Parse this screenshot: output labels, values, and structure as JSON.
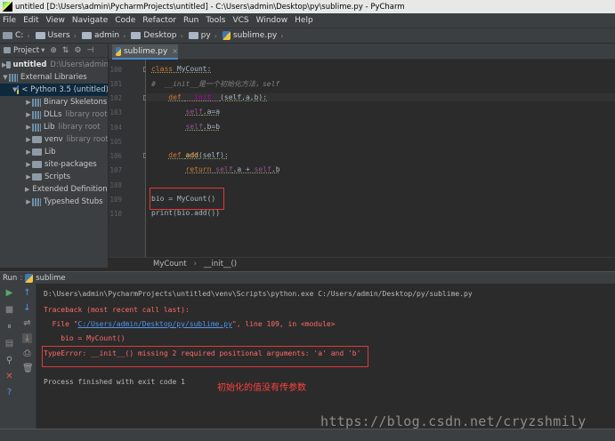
{
  "window": {
    "title": "untitled [D:\\Users\\admin\\PycharmProjects\\untitled] - C:\\Users\\admin\\Desktop\\py\\sublime.py - PyCharm"
  },
  "menu": [
    "File",
    "Edit",
    "View",
    "Navigate",
    "Code",
    "Refactor",
    "Run",
    "Tools",
    "VCS",
    "Window",
    "Help"
  ],
  "navbar": {
    "crumbs": [
      "C:",
      "Users",
      "admin",
      "Desktop",
      "py",
      "sublime.py"
    ]
  },
  "project": {
    "header": "Project",
    "tree": [
      {
        "label": "untitled",
        "hint": "D:\\Users\\admin"
      },
      {
        "label": "External Libraries",
        "hint": ""
      },
      {
        "label": "< Python 3.5 (untitled)",
        "hint": ""
      },
      {
        "label": "Binary Skeletons",
        "hint": ""
      },
      {
        "label": "DLLs",
        "hint": "library root"
      },
      {
        "label": "Lib",
        "hint": "library root"
      },
      {
        "label": "venv",
        "hint": "library root"
      },
      {
        "label": "Lib",
        "hint": ""
      },
      {
        "label": "site-packages",
        "hint": ""
      },
      {
        "label": "Scripts",
        "hint": ""
      },
      {
        "label": "Extended Definitions",
        "hint": ""
      },
      {
        "label": "Typeshed Stubs",
        "hint": ""
      }
    ]
  },
  "editor": {
    "tab": "sublime.py",
    "line_numbers": [
      "100",
      "101",
      "102",
      "103",
      "104",
      "105",
      "106",
      "107",
      "108",
      "109",
      "110"
    ],
    "lines": {
      "l100_kw": "class ",
      "l100_name": "MyCount",
      "l100_end": ":",
      "l101": "#  __init__是一个初始化方法，self",
      "l102_kw": "def ",
      "l102_name": "__init__",
      "l102_args": "(self,a,b):",
      "l103_self": "self",
      "l103_rest": ".a=a",
      "l104_self": "self",
      "l104_rest": ".b=b",
      "l106_kw": "def ",
      "l106_name": "add",
      "l106_rest": "(self):",
      "l107_kw": "return ",
      "l107_self1": "self",
      "l107_mid": ".a + ",
      "l107_self2": "self",
      "l107_end": ".b",
      "l109": "bio = MyCount()",
      "l110": "print(bio.add())"
    },
    "breadcrumbs": [
      "MyCount",
      "__init__()"
    ]
  },
  "run": {
    "header": "Run",
    "config": "sublime",
    "console": {
      "cmd": "D:\\Users\\admin\\PycharmProjects\\untitled\\venv\\Scripts\\python.exe C:/Users/admin/Desktop/py/sublime.py",
      "traceback": "Traceback (most recent call last):",
      "file_pre": "  File \"",
      "file_link": "C:/Users/admin/Desktop/py/sublime.py",
      "file_post": "\", line 109, in <module>",
      "src": "    bio = MyCount()",
      "error": "TypeError: __init__() missing 2 required positional arguments: 'a' and 'b'",
      "exit": "Process finished with exit code 1"
    },
    "annotation": "初始化的值没有传参数"
  },
  "watermark": "https://blog.csdn.net/cryzshmily"
}
